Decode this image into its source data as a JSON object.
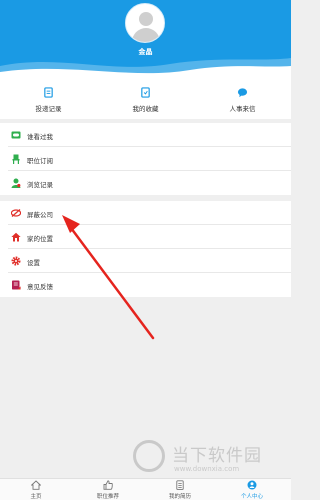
{
  "profile": {
    "username": "金晶"
  },
  "quick_actions": [
    {
      "label": "投递记录",
      "icon": "document-icon"
    },
    {
      "label": "我的收藏",
      "icon": "bookmark-icon"
    },
    {
      "label": "人事来信",
      "icon": "chat-icon"
    }
  ],
  "menu_group_1": [
    {
      "label": "谁看过我",
      "icon": "eye-card-icon"
    },
    {
      "label": "职位订阅",
      "icon": "chair-icon"
    },
    {
      "label": "浏览记录",
      "icon": "person-icon"
    }
  ],
  "menu_group_2": [
    {
      "label": "屏蔽公司",
      "icon": "block-icon"
    },
    {
      "label": "家的位置",
      "icon": "home-icon"
    },
    {
      "label": "设置",
      "icon": "gear-icon"
    },
    {
      "label": "意见反馈",
      "icon": "feedback-icon"
    }
  ],
  "tabbar": [
    {
      "label": "主页",
      "icon": "home-tab-icon",
      "active": false
    },
    {
      "label": "职位推荐",
      "icon": "thumbs-up-icon",
      "active": false
    },
    {
      "label": "我的简历",
      "icon": "resume-icon",
      "active": false
    },
    {
      "label": "个人中心",
      "icon": "person-tab-icon",
      "active": true
    }
  ],
  "watermark": {
    "title": "当下软件园",
    "url": "www.downxia.com"
  },
  "colors": {
    "primary": "#1a9ae4",
    "accent_green": "#2fae4e",
    "accent_red": "#e0302a",
    "annotation_arrow": "#e5241e"
  }
}
